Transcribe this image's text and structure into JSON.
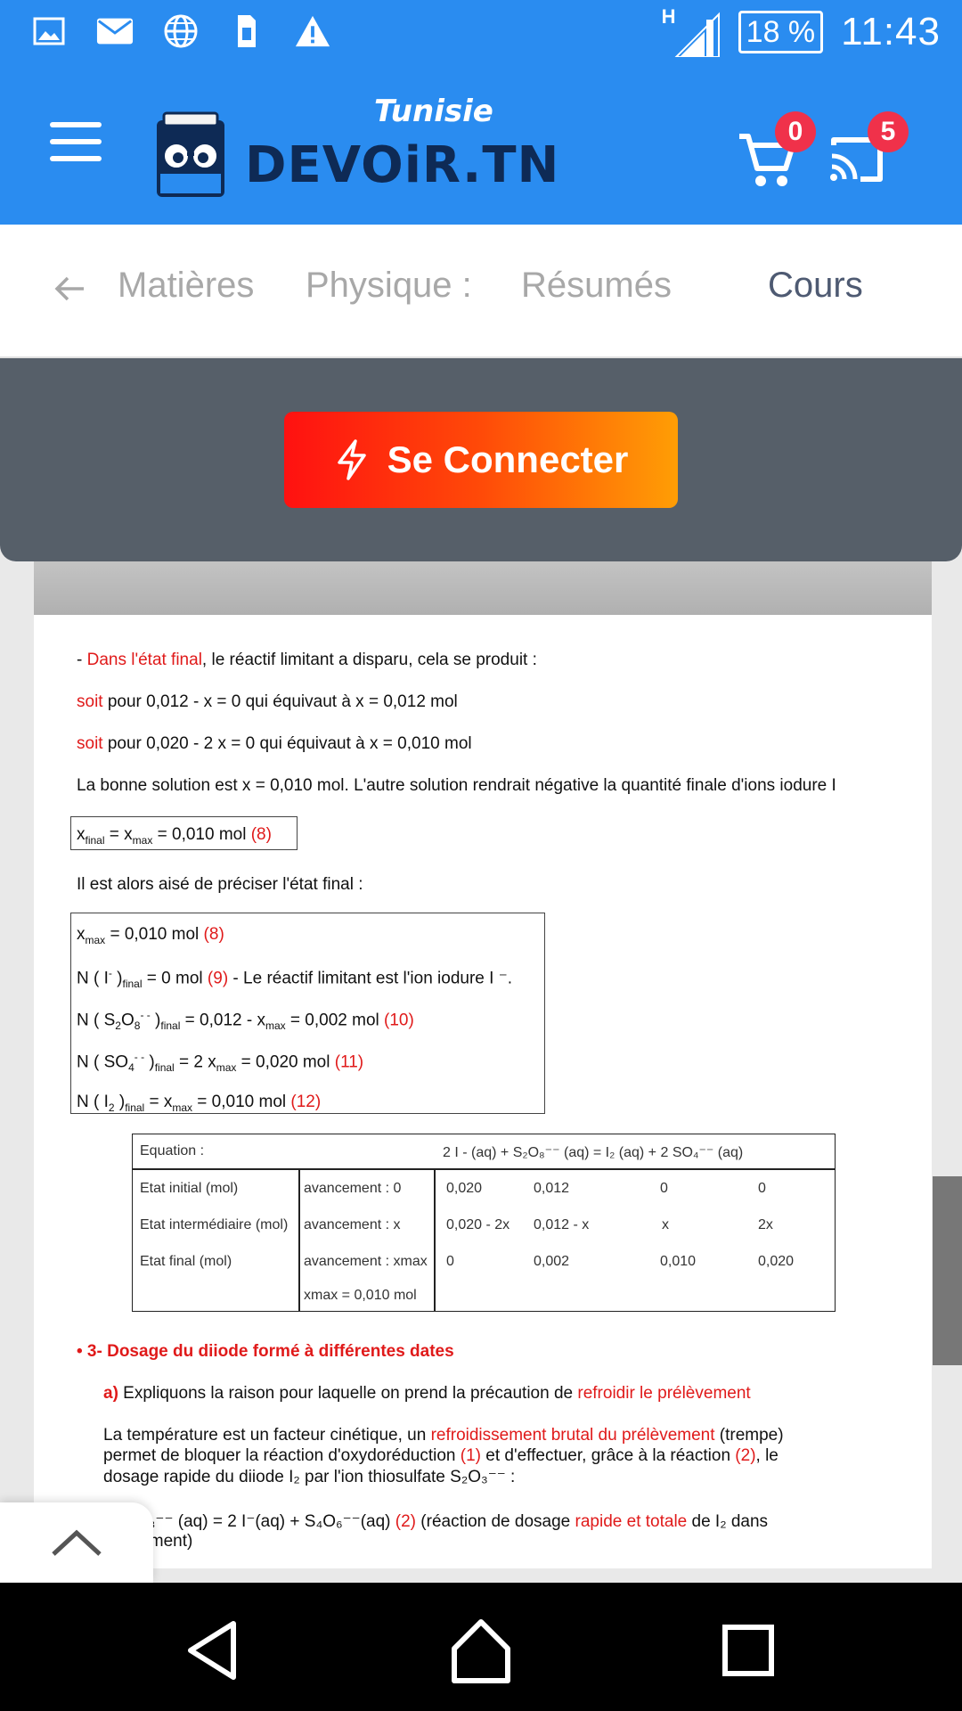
{
  "status_bar": {
    "left_icons": [
      "image-icon",
      "mail-icon",
      "globe-icon",
      "sim-icon",
      "warning-icon"
    ],
    "network_label": "H",
    "battery": "18 %",
    "time": "11:43"
  },
  "app_bar": {
    "logo_tagline": "Tunisie",
    "logo_name": "DEVOiR.TN",
    "cart_count": "0",
    "cast_count": "5",
    "color": "#2a8cf0",
    "badge_color": "#f0314a"
  },
  "breadcrumb": {
    "items": [
      "Matières",
      "Physique :",
      "Résumés",
      "Cours"
    ]
  },
  "login": {
    "label": "Se Connecter"
  },
  "document": {
    "l1_a": "- ",
    "l1_red": "Dans l'état final",
    "l1_b": ", le réactif limitant a disparu, cela se produit :",
    "l2_red": "soit",
    "l2_b": " pour 0,012 - x = 0 qui équivaut à x = 0,012 mol",
    "l3_red": "soit",
    "l3_b": " pour 0,020 - 2 x = 0 qui équivaut à x = 0,010 mol",
    "l4": "La bonne solution est x = 0,010 mol. L'autre solution rendrait négative la quantité finale d'ions iodure I",
    "xfinal_eq": " = 0,010 mol ",
    "xfinal_ref": "(8)",
    "l5": "Il est alors aisé de préciser l'état final :",
    "b1_val": " = 0,010 mol ",
    "b1_ref": "(8)",
    "b2_val": " = 0 mol ",
    "b2_ref": "(9)",
    "b2_tail": " - Le réactif limitant est l'ion iodure I ⁻.",
    "b3_val": " = 0,002 mol ",
    "b3_ref": "(10)",
    "b4_val": " = 0,020 mol ",
    "b4_ref": "(11)",
    "b5_val": " = 0,010 mol ",
    "b5_ref": "(12)",
    "table": {
      "header_label": "Equation :",
      "header_eq": "2 I - (aq)   +   S₂O₈⁻⁻ (aq)   =   I₂ (aq)    +    2 SO₄⁻⁻ (aq)",
      "rows": [
        {
          "label": "Etat initial (mol)",
          "adv": "avancement : 0",
          "c1": "0,020",
          "c2": "0,012",
          "c3": "0",
          "c4": "0"
        },
        {
          "label": "Etat intermédiaire (mol)",
          "adv": "avancement : x",
          "c1": "0,020 - 2x",
          "c2": "0,012 - x",
          "c3": "x",
          "c4": "2x"
        },
        {
          "label": "Etat final (mol)",
          "adv": "avancement : xmax",
          "c1": "0",
          "c2": "0,002",
          "c3": "0,010",
          "c4": "0,020"
        }
      ],
      "adv_extra": "xmax = 0,010 mol"
    },
    "s3_title": "• 3- Dosage du diiode formé à différentes dates",
    "a_label": "a)",
    "a_text": "  Expliquons la raison pour laquelle on prend la précaution de ",
    "a_red": "refroidir le prélèvement",
    "p1_a": "La température est un facteur cinétique, un ",
    "p1_red": "refroidissement brutal du prélèvement",
    "p1_b": " (trempe)",
    "p2_a": "permet de bloquer la réaction d'oxydoréduction ",
    "p2_r1": "(1)",
    "p2_b": " et d'effectuer, grâce à la réaction ",
    "p2_r2": "(2)",
    "p2_c": ", le",
    "p3": "dosage rapide du diiode I₂ par l'ion thiosulfate S₂O₃⁻⁻ :",
    "p4_a": "2 S₂O₃⁻⁻ (aq) = 2 I⁻(aq) + S₄O₆⁻⁻(aq) ",
    "p4_r": "(2)",
    "p4_b": " (réaction de dosage ",
    "p4_red": "rapide et totale",
    "p4_c": " de I₂ dans",
    "p5": "rélèvement)"
  },
  "nav": [
    "back-nav-icon",
    "home-nav-icon",
    "recents-nav-icon"
  ]
}
